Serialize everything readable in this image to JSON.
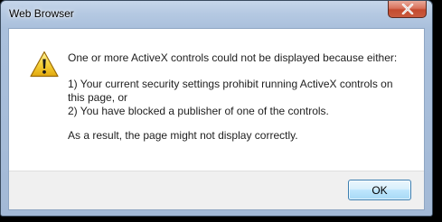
{
  "window": {
    "title": "Web Browser"
  },
  "dialog": {
    "heading": "One or more ActiveX controls could not be displayed because either:",
    "reason_1": "1) Your current security settings prohibit running ActiveX controls on this page, or",
    "reason_2": "2) You have blocked a publisher of one of the controls.",
    "conclusion": "As a result, the page might not display correctly.",
    "ok_label": "OK",
    "icon": "warning-icon"
  },
  "colors": {
    "warning_yellow": "#f5c518",
    "close_red": "#c44a2f",
    "ok_border": "#3c7fb1"
  }
}
